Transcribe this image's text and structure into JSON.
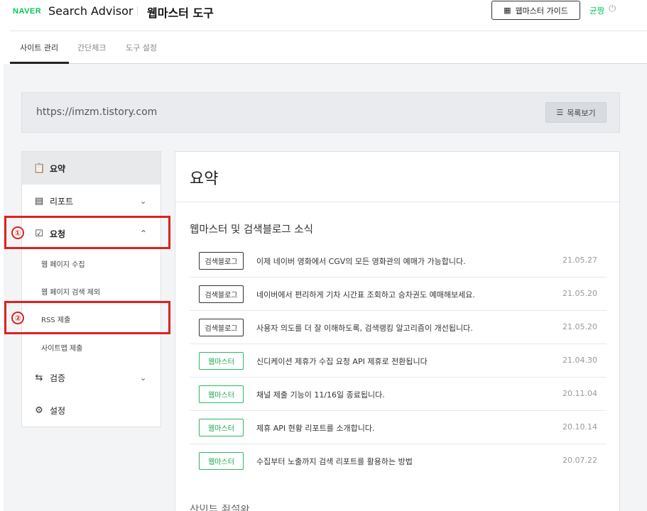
{
  "header": {
    "logo": "NAVER",
    "app_name": "Search Advisor",
    "tool_title": "웹마스터 도구",
    "guide_button": "웹마스터 가이드",
    "user_name": "균짱"
  },
  "tabs": [
    {
      "label": "사이트 관리",
      "active": true
    },
    {
      "label": "간단체크",
      "active": false
    },
    {
      "label": "도구 설정",
      "active": false
    }
  ],
  "site": {
    "url": "https://imzm.tistory.com",
    "list_button": "목록보기"
  },
  "sidebar": {
    "summary": "요약",
    "report": "리포트",
    "request": "요청",
    "request_sub": [
      "웹 페이지 수집",
      "웹 페이지 검색 제외",
      "RSS 제출",
      "사이트맵 제출"
    ],
    "verify": "검증",
    "settings": "설정"
  },
  "annotations": {
    "one": "①",
    "two": "②"
  },
  "main": {
    "title": "요약",
    "section_title": "웹마스터 및 검색블로그 소식",
    "news": [
      {
        "badge": "검색블로그",
        "text": "이제 네이버 영화에서 CGV의 모든 영화관의 예매가 가능합니다.",
        "date": "21.05.27"
      },
      {
        "badge": "검색블로그",
        "text": "네이버에서 편리하게 기차 시간표 조회하고 승차권도 예매해보세요.",
        "date": "21.05.20"
      },
      {
        "badge": "검색블로그",
        "text": "사용자 의도를 더 잘 이해하도록, 검색랭킹 알고리즘이 개선됩니다.",
        "date": "21.05.20"
      },
      {
        "badge": "웹마스터",
        "text": "신디케이션 제휴가 수집 요청 API 제휴로 전환됩니다",
        "date": "21.04.30"
      },
      {
        "badge": "웹마스터",
        "text": "채널 제출 기능이 11/16일 종료됩니다.",
        "date": "20.11.04"
      },
      {
        "badge": "웹마스터",
        "text": "제휴 API 현황 리포트를 소개합니다.",
        "date": "20.10.14"
      },
      {
        "badge": "웹마스터",
        "text": "수집부터 노출까지 검색 리포트를 활용하는 방법",
        "date": "20.07.22"
      }
    ],
    "next_section_partial": "사이트 최적화"
  },
  "colors": {
    "brand_green": "#03c75a",
    "annotation_red": "#e02020"
  }
}
